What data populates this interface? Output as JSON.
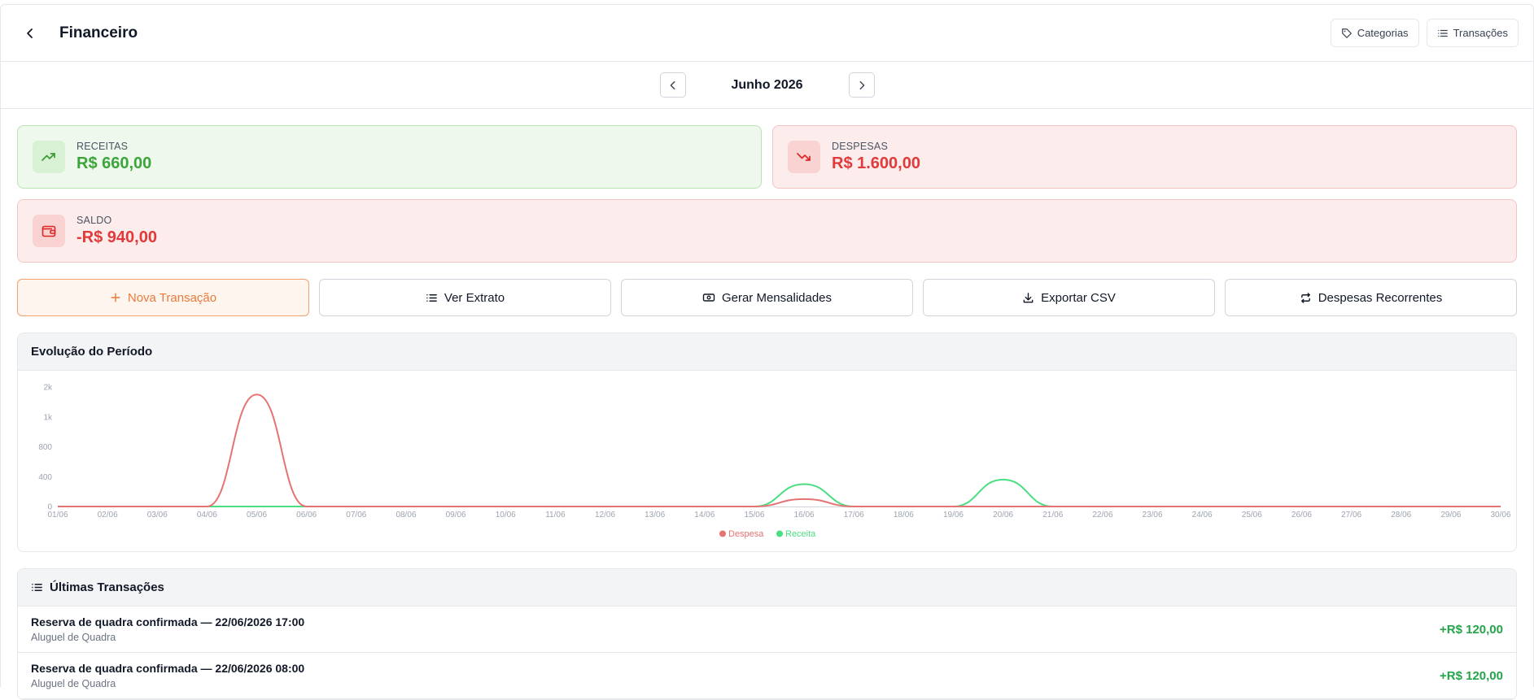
{
  "header": {
    "title": "Financeiro",
    "categories_label": "Categorias",
    "transactions_label": "Transações"
  },
  "period": {
    "label": "Junho 2026"
  },
  "summary": {
    "receitas": {
      "label": "RECEITAS",
      "value": "R$ 660,00"
    },
    "despesas": {
      "label": "DESPESAS",
      "value": "R$ 1.600,00"
    },
    "saldo": {
      "label": "SALDO",
      "value": "-R$ 940,00"
    }
  },
  "actions": {
    "nova_transacao": "Nova Transação",
    "ver_extrato": "Ver Extrato",
    "gerar_mensalidades": "Gerar Mensalidades",
    "exportar_csv": "Exportar CSV",
    "despesas_recorrentes": "Despesas Recorrentes"
  },
  "chart_panel": {
    "title": "Evolução do Período"
  },
  "chart_data": {
    "type": "area",
    "title": "Evolução do Período",
    "x": [
      "01/06",
      "02/06",
      "03/06",
      "04/06",
      "05/06",
      "06/06",
      "07/06",
      "08/06",
      "09/06",
      "10/06",
      "11/06",
      "12/06",
      "13/06",
      "14/06",
      "15/06",
      "16/06",
      "17/06",
      "18/06",
      "19/06",
      "20/06",
      "21/06",
      "22/06",
      "23/06",
      "24/06",
      "25/06",
      "26/06",
      "27/06",
      "28/06",
      "29/06",
      "30/06"
    ],
    "y_ticks": [
      {
        "value": 0,
        "label": "0"
      },
      {
        "value": 400,
        "label": "400"
      },
      {
        "value": 800,
        "label": "800"
      },
      {
        "value": 1200,
        "label": "1k"
      },
      {
        "value": 1600,
        "label": "2k"
      }
    ],
    "ylim": [
      0,
      1600
    ],
    "series": [
      {
        "name": "Despesa",
        "color": "#e57373",
        "values": [
          0,
          0,
          0,
          0,
          1500,
          0,
          0,
          0,
          0,
          0,
          0,
          0,
          0,
          0,
          0,
          100,
          0,
          0,
          0,
          0,
          0,
          0,
          0,
          0,
          0,
          0,
          0,
          0,
          0,
          0
        ]
      },
      {
        "name": "Receita",
        "color": "#4ade80",
        "values": [
          0,
          0,
          0,
          0,
          0,
          0,
          0,
          0,
          0,
          0,
          0,
          0,
          0,
          0,
          0,
          300,
          0,
          0,
          0,
          360,
          0,
          0,
          0,
          0,
          0,
          0,
          0,
          0,
          0,
          0
        ]
      }
    ],
    "legend": "bottom-center",
    "grid": false
  },
  "transactions_panel": {
    "title": "Últimas Transações",
    "items": [
      {
        "title": "Reserva de quadra confirmada — 22/06/2026 17:00",
        "category": "Aluguel de Quadra",
        "amount": "+R$ 120,00"
      },
      {
        "title": "Reserva de quadra confirmada — 22/06/2026 08:00",
        "category": "Aluguel de Quadra",
        "amount": "+R$ 120,00"
      }
    ]
  },
  "colors": {
    "accent": "#ea7a3a",
    "income": "#3ba53b",
    "expense": "#e03a3a"
  }
}
